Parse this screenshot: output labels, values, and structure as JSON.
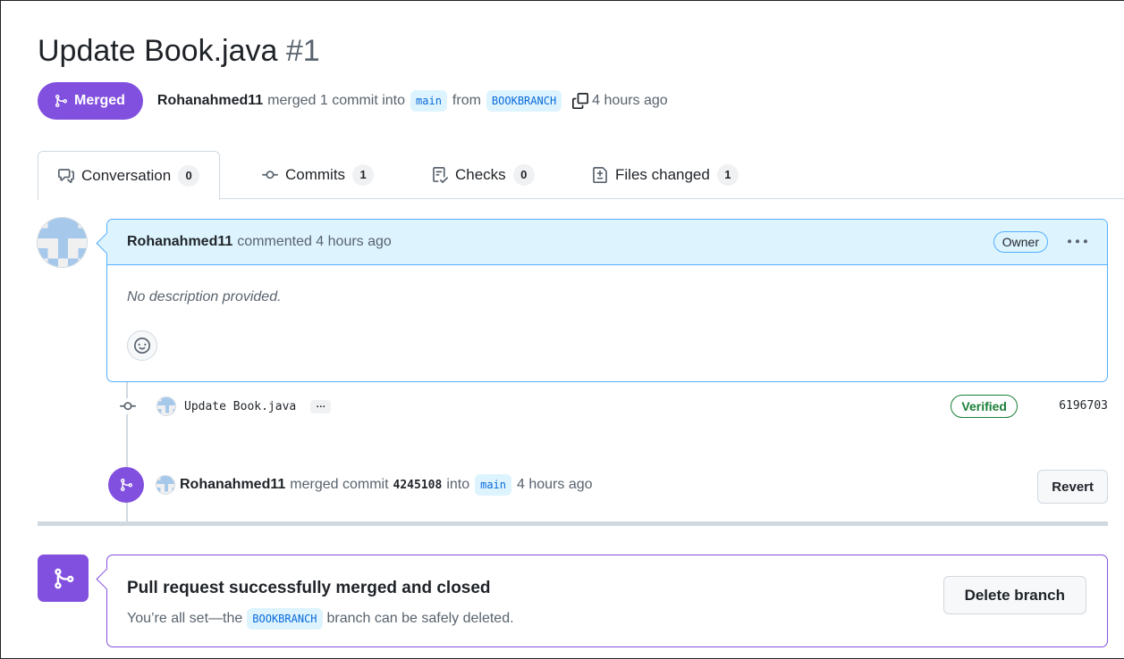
{
  "header": {
    "title": "Update Book.java",
    "number": "#1",
    "state_label": "Merged",
    "author": "Rohanahmed11",
    "merged_text": "merged 1 commit into",
    "base_branch": "main",
    "from_text": "from",
    "head_branch": "BOOKBRANCH",
    "time": "4 hours ago"
  },
  "tabs": [
    {
      "label": "Conversation",
      "count": "0"
    },
    {
      "label": "Commits",
      "count": "1"
    },
    {
      "label": "Checks",
      "count": "0"
    },
    {
      "label": "Files changed",
      "count": "1"
    }
  ],
  "comment": {
    "author": "Rohanahmed11",
    "action": "commented 4 hours ago",
    "role": "Owner",
    "body": "No description provided."
  },
  "commit": {
    "message": "Update Book.java",
    "ellipsis": "…",
    "verified_label": "Verified",
    "sha": "6196703"
  },
  "merge_event": {
    "author": "Rohanahmed11",
    "text1": "merged commit",
    "sha": "4245108",
    "text2": "into",
    "branch": "main",
    "time": "4 hours ago",
    "revert_label": "Revert"
  },
  "merge_box": {
    "title": "Pull request successfully merged and closed",
    "sub_prefix": "You’re all set—the",
    "branch": "BOOKBRANCH",
    "sub_suffix": "branch can be safely deleted.",
    "delete_label": "Delete branch"
  },
  "colors": {
    "merged_purple": "#8250df",
    "accent_blue": "#0969da",
    "comment_header_bg": "#ddf4ff",
    "verified_green": "#1a7f37"
  }
}
